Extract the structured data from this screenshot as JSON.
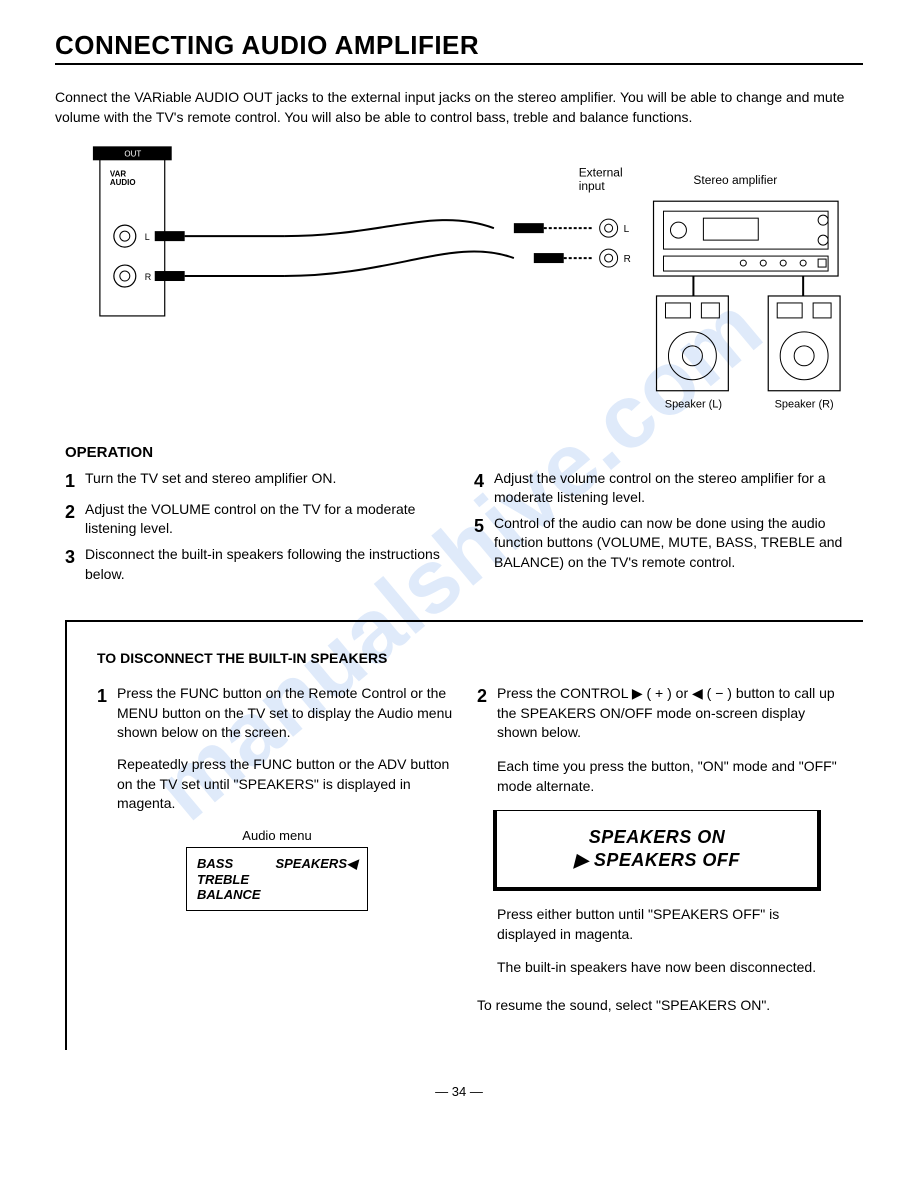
{
  "title": "CONNECTING AUDIO AMPLIFIER",
  "intro": "Connect the VARiable AUDIO OUT jacks to the external input jacks on the stereo amplifier. You will be able to change and mute volume with the TV's remote control. You will also be able to control bass, treble and balance functions.",
  "diagram": {
    "out": "OUT",
    "var_audio": "VAR\nAUDIO",
    "l": "L",
    "r": "R",
    "ext_input": "External\ninput",
    "stereo_amp": "Stereo amplifier",
    "speaker_l": "Speaker (L)",
    "speaker_r": "Speaker (R)"
  },
  "operation_head": "OPERATION",
  "ops": {
    "s1": "Turn the TV set and stereo amplifier ON.",
    "s2": "Adjust the VOLUME control on the TV for a moderate listening level.",
    "s3": "Disconnect the built-in speakers following the instructions below.",
    "s4": "Adjust the volume control on the stereo amplifier for a moderate listening level.",
    "s5": "Control of the audio can now be done using the audio function buttons (VOLUME, MUTE, BASS, TREBLE and BALANCE) on the TV's remote control."
  },
  "disconnect": {
    "head": "TO DISCONNECT THE BUILT-IN SPEAKERS",
    "s1a": "Press the FUNC button on the Remote Control or the MENU button on the TV set to display the Audio menu shown below on the screen.",
    "s1b": "Repeatedly press the FUNC button or the ADV button on the TV set until \"SPEAKERS\" is displayed in magenta.",
    "menu_cap": "Audio menu",
    "menu": {
      "bass": "BASS",
      "treble": "TREBLE",
      "balance": "BALANCE",
      "speakers": "SPEAKERS"
    },
    "s2a": "Press the CONTROL ▶ ( + ) or ◀ ( − ) button to call up the SPEAKERS ON/OFF mode on-screen display shown below.",
    "s2b": "Each time you press the button, \"ON\" mode and \"OFF\" mode alternate.",
    "onoff": {
      "on": "SPEAKERS ON",
      "off": "SPEAKERS OFF"
    },
    "s2c": "Press either button until \"SPEAKERS OFF\" is displayed in magenta.",
    "s2d": "The built-in speakers have now been disconnected.",
    "resume": "To resume the sound, select \"SPEAKERS ON\"."
  },
  "page": "— 34 —",
  "watermark": "manualshive.com"
}
